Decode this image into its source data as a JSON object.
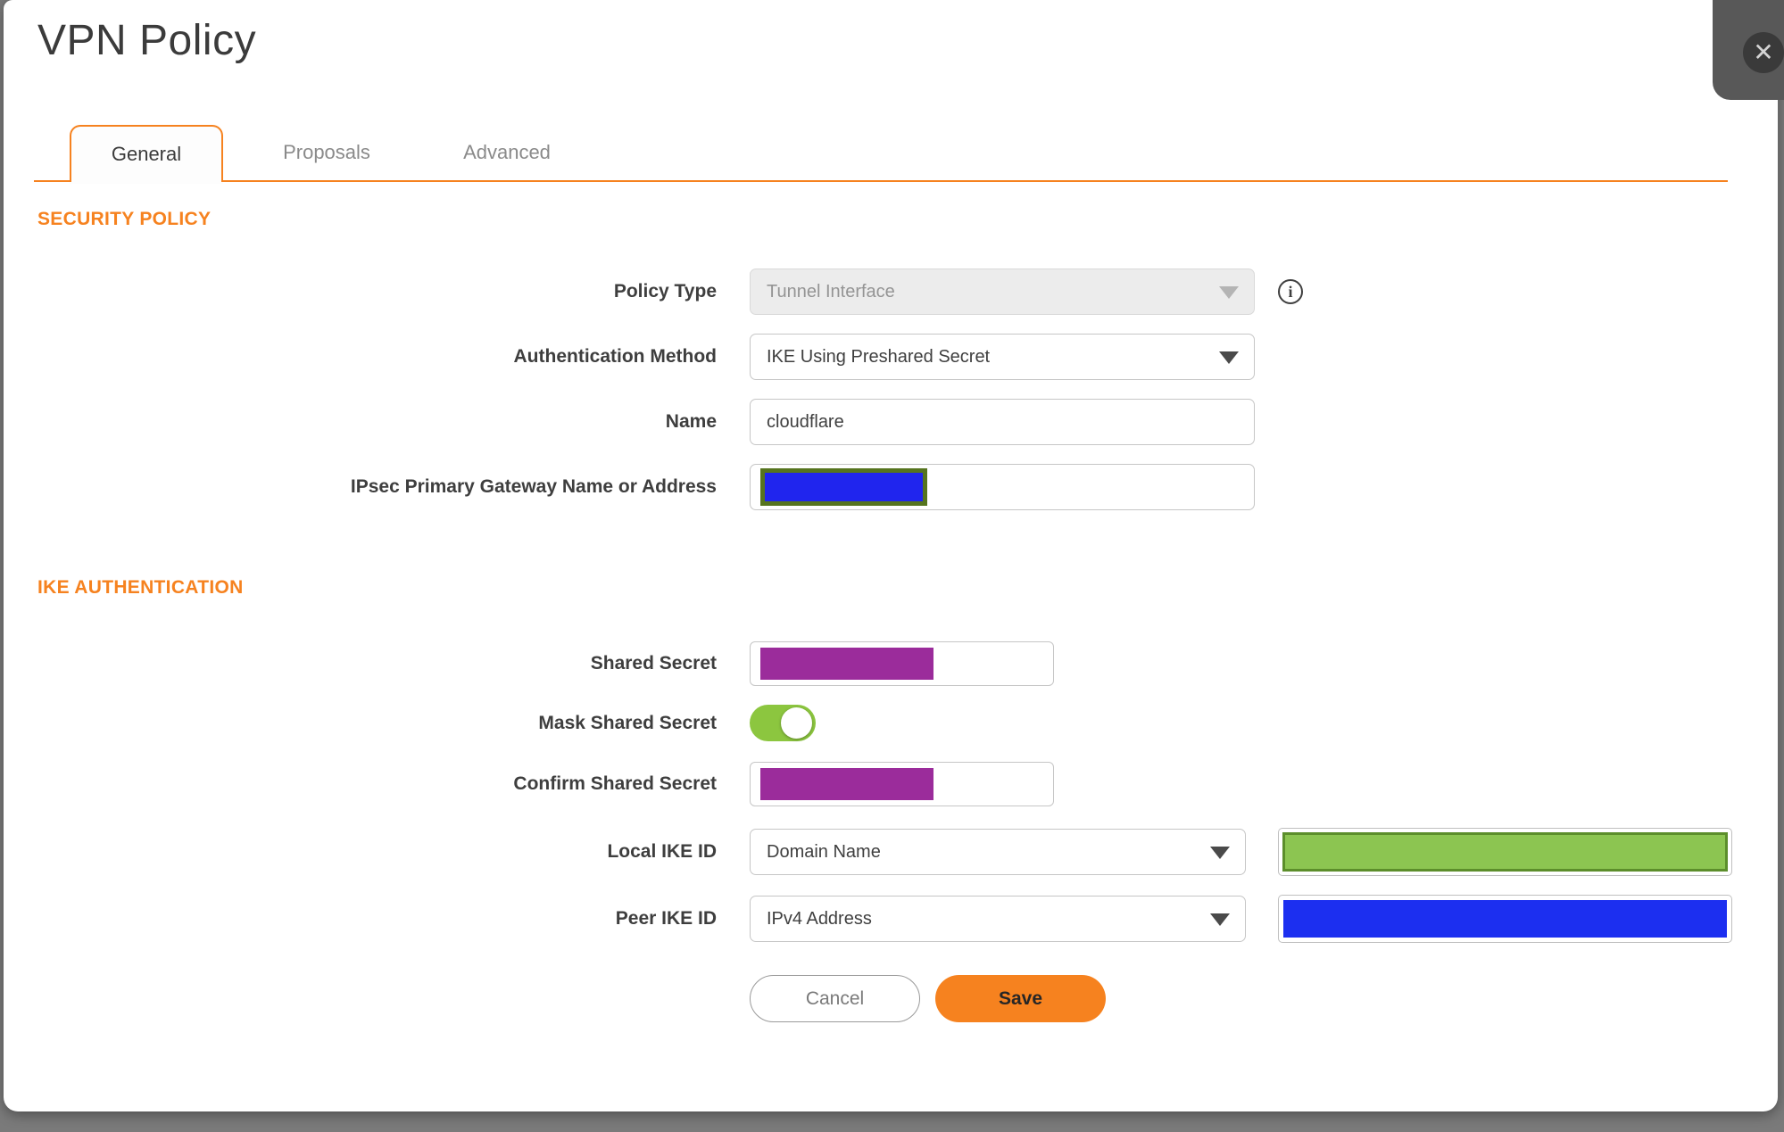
{
  "dialog": {
    "title": "VPN Policy",
    "close_glyph": "✕"
  },
  "tabs": [
    {
      "label": "General",
      "active": true
    },
    {
      "label": "Proposals",
      "active": false
    },
    {
      "label": "Advanced",
      "active": false
    }
  ],
  "sections": {
    "security_policy": "SECURITY POLICY",
    "ike_authentication": "IKE AUTHENTICATION"
  },
  "fields": {
    "policy_type": {
      "label": "Policy Type",
      "value": "Tunnel Interface",
      "disabled": true
    },
    "auth_method": {
      "label": "Authentication Method",
      "value": "IKE Using Preshared Secret"
    },
    "name": {
      "label": "Name",
      "value": "cloudflare"
    },
    "gateway": {
      "label": "IPsec Primary Gateway Name or Address",
      "value_redacted": "blue-box"
    },
    "shared_secret": {
      "label": "Shared Secret",
      "value_redacted": "purple-box"
    },
    "mask_shared_secret": {
      "label": "Mask Shared Secret",
      "state": "on"
    },
    "confirm_shared_secret": {
      "label": "Confirm Shared Secret",
      "value_redacted": "purple-box"
    },
    "local_ike_id": {
      "label": "Local IKE ID",
      "value": "Domain Name",
      "side_value_redacted": "green-box"
    },
    "peer_ike_id": {
      "label": "Peer IKE ID",
      "value": "IPv4 Address",
      "side_value_redacted": "blue-box"
    }
  },
  "icons": {
    "info_glyph": "i"
  },
  "buttons": {
    "cancel": "Cancel",
    "save": "Save"
  },
  "colors": {
    "accent_orange": "#f6821f",
    "toggle_green": "#8cc63f",
    "redact_blue": "#2025ee",
    "redact_blue_border_olive": "#56741f",
    "redact_purple": "#9b2c9b",
    "redact_green": "#8cc551",
    "redact_green_border": "#5c8e2b",
    "backdrop_gray": "#7a7a7a",
    "close_circle": "#3a3a3a"
  }
}
